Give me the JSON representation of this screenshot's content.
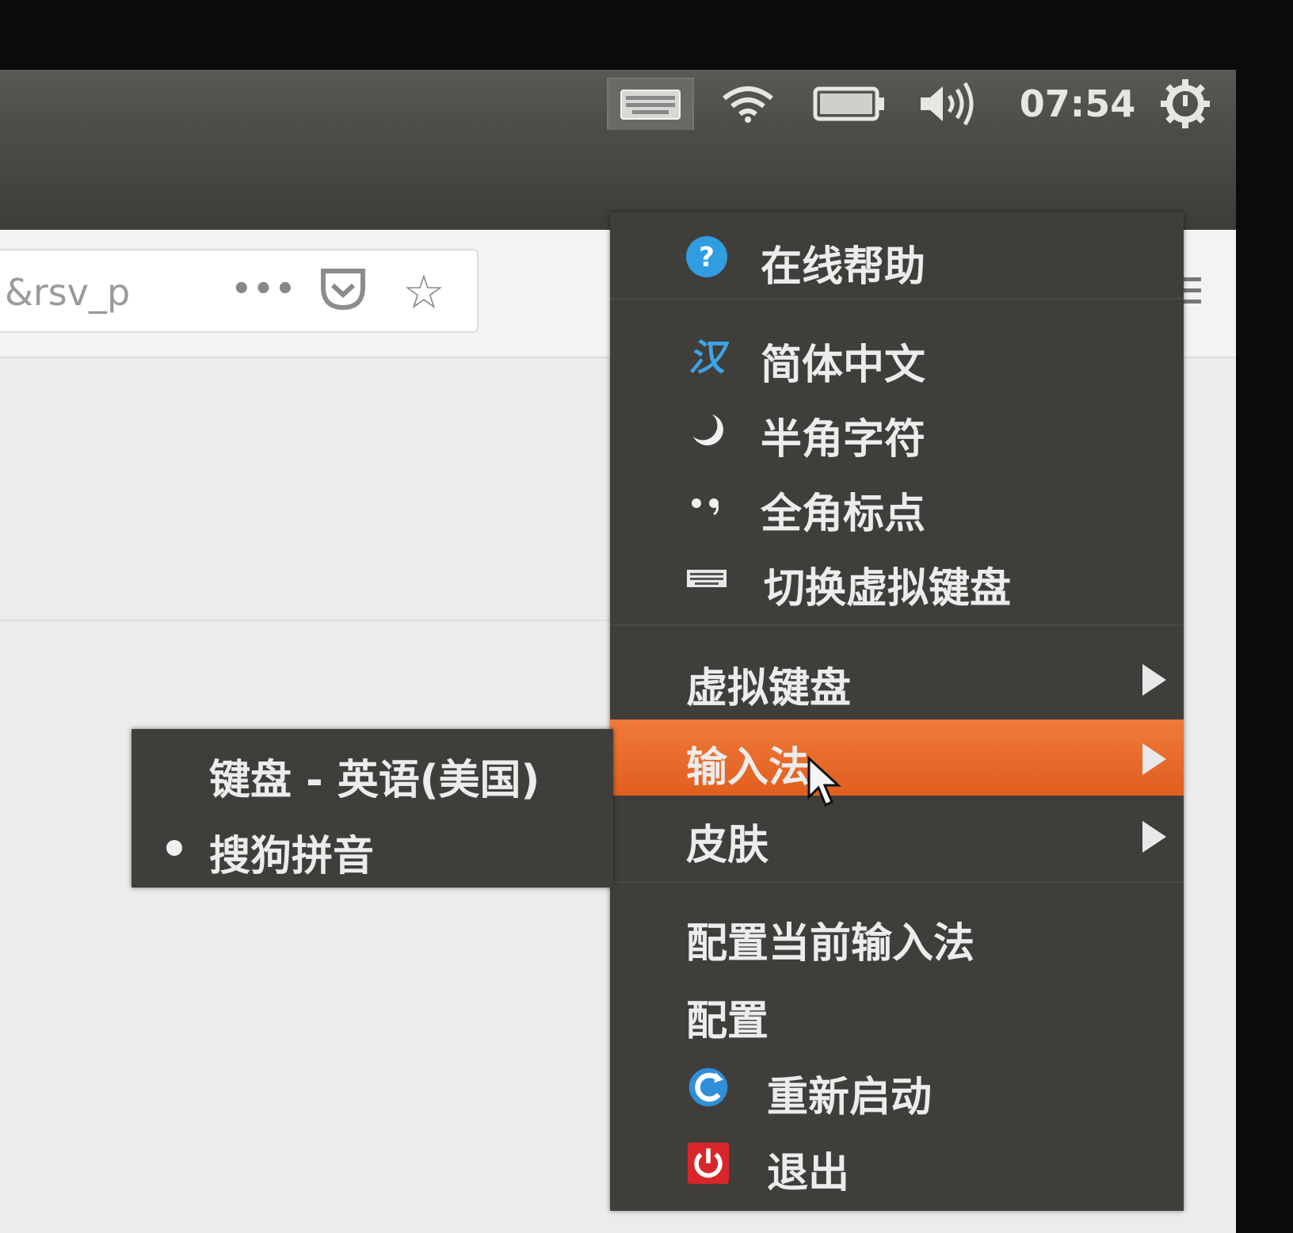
{
  "panel": {
    "clock": "07:54",
    "icons": [
      "keyboard-indicator-icon",
      "wifi-icon",
      "battery-icon",
      "volume-icon",
      "gear-icon"
    ]
  },
  "browser": {
    "url_fragment": "&rsv_p",
    "more_label": "•••"
  },
  "menu": {
    "items": [
      {
        "label": "在线帮助",
        "icon": "help-icon"
      },
      {
        "label": "简体中文",
        "icon_text": "汉"
      },
      {
        "label": "半角字符",
        "icon": "half-moon-icon"
      },
      {
        "label": "全角标点",
        "icon": "punctuation-icon"
      },
      {
        "label": "切换虚拟键盘",
        "icon": "keyboard-icon"
      },
      {
        "label": "虚拟键盘",
        "has_submenu": true
      },
      {
        "label": "输入法",
        "has_submenu": true,
        "active": true
      },
      {
        "label": "皮肤",
        "has_submenu": true
      },
      {
        "label": "配置当前输入法"
      },
      {
        "label": "配置"
      },
      {
        "label": "重新启动",
        "icon": "restart-icon"
      },
      {
        "label": "退出",
        "icon": "power-icon"
      }
    ]
  },
  "submenu": {
    "items": [
      {
        "label": "键盘 - 英语(美国)",
        "selected": false
      },
      {
        "label": "搜狗拼音",
        "selected": true
      }
    ]
  },
  "colors": {
    "menu_bg": "#3f3e3b",
    "highlight": "#e8682a",
    "panel_bg": "#4f4f4b"
  }
}
